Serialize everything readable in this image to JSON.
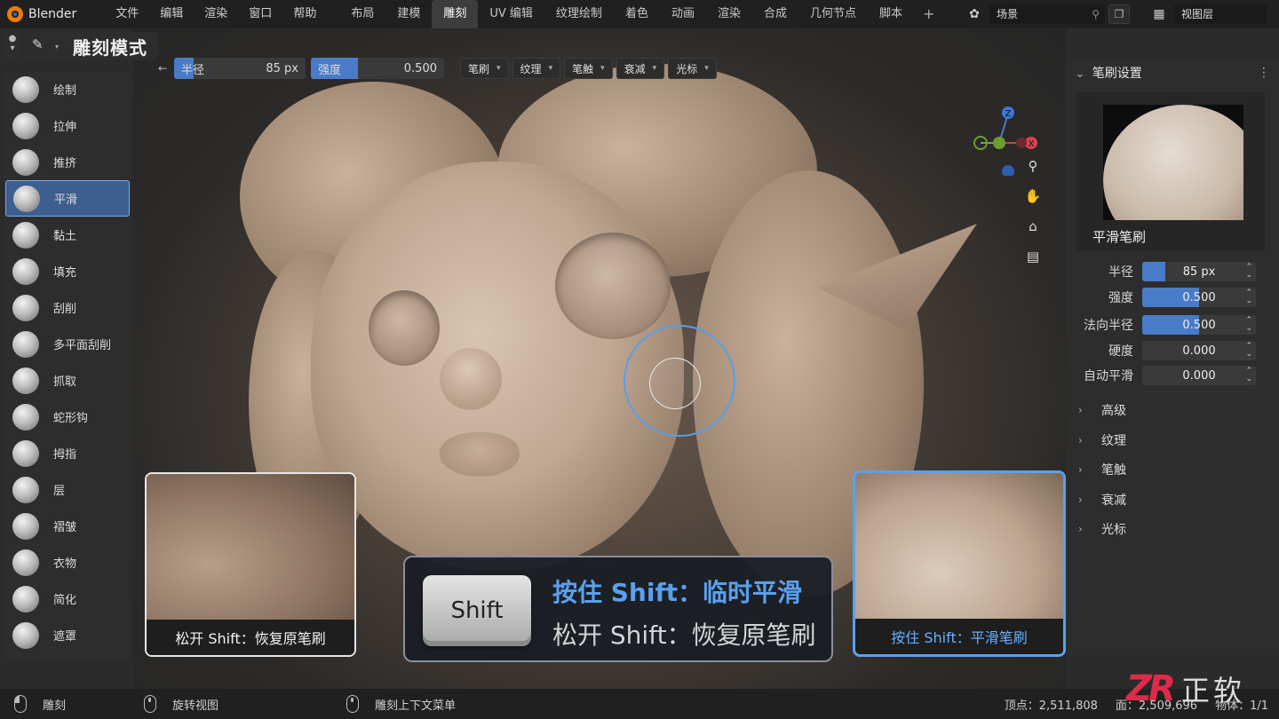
{
  "app": {
    "name": "Blender"
  },
  "menu": [
    "文件",
    "编辑",
    "渲染",
    "窗口",
    "帮助"
  ],
  "workspaces": [
    "布局",
    "建模",
    "雕刻",
    "UV 编辑",
    "纹理绘制",
    "着色",
    "动画",
    "渲染",
    "合成",
    "几何节点",
    "脚本"
  ],
  "active_workspace": "雕刻",
  "scene": {
    "name": "场景"
  },
  "view_layer": {
    "name": "视图层"
  },
  "mode": {
    "label": "雕刻模式"
  },
  "header": {
    "radius_label": "半径",
    "radius_value": "85 px",
    "radius_fill": 0.15,
    "strength_label": "强度",
    "strength_value": "0.500",
    "strength_fill": 0.35,
    "dropdowns": [
      "笔刷",
      "纹理",
      "笔触",
      "衰减",
      "光标"
    ]
  },
  "tools": [
    "绘制",
    "拉伸",
    "推挤",
    "平滑",
    "黏土",
    "填充",
    "刮削",
    "多平面刮削",
    "抓取",
    "蛇形钩",
    "拇指",
    "层",
    "褶皱",
    "衣物",
    "简化",
    "遮罩"
  ],
  "active_tool": "平滑",
  "brush_panel": {
    "title": "笔刷设置",
    "brush_name": "平滑笔刷",
    "props": [
      {
        "label": "半径",
        "value": "85 px",
        "fill": 0.2
      },
      {
        "label": "强度",
        "value": "0.500",
        "fill": 0.5
      },
      {
        "label": "法向半径",
        "value": "0.500",
        "fill": 0.5
      },
      {
        "label": "硬度",
        "value": "0.000",
        "fill": 0
      },
      {
        "label": "自动平滑",
        "value": "0.000",
        "fill": 0
      }
    ],
    "sections": [
      "高级",
      "纹理",
      "笔触",
      "衰减",
      "光标"
    ]
  },
  "insets": {
    "left_caption": "松开 Shift：恢复原笔刷",
    "right_caption": "按住 Shift：平滑笔刷"
  },
  "shift_tip": {
    "key": "Shift",
    "line1": "按住 Shift：临时平滑",
    "line2": "松开 Shift：恢复原笔刷"
  },
  "status": {
    "left_click": "雕刻",
    "middle_click": "旋转视图",
    "right_click": "雕刻上下文菜单",
    "verts": "顶点：2,511,808",
    "faces": "面：2,509,696",
    "objects": "物体：1/1"
  },
  "watermark": {
    "logo": "ZR",
    "text": "正软"
  },
  "colors": {
    "accent": "#4a7bc7",
    "highlight_border": "#5aa0ee",
    "brand": "#e87d0d"
  }
}
